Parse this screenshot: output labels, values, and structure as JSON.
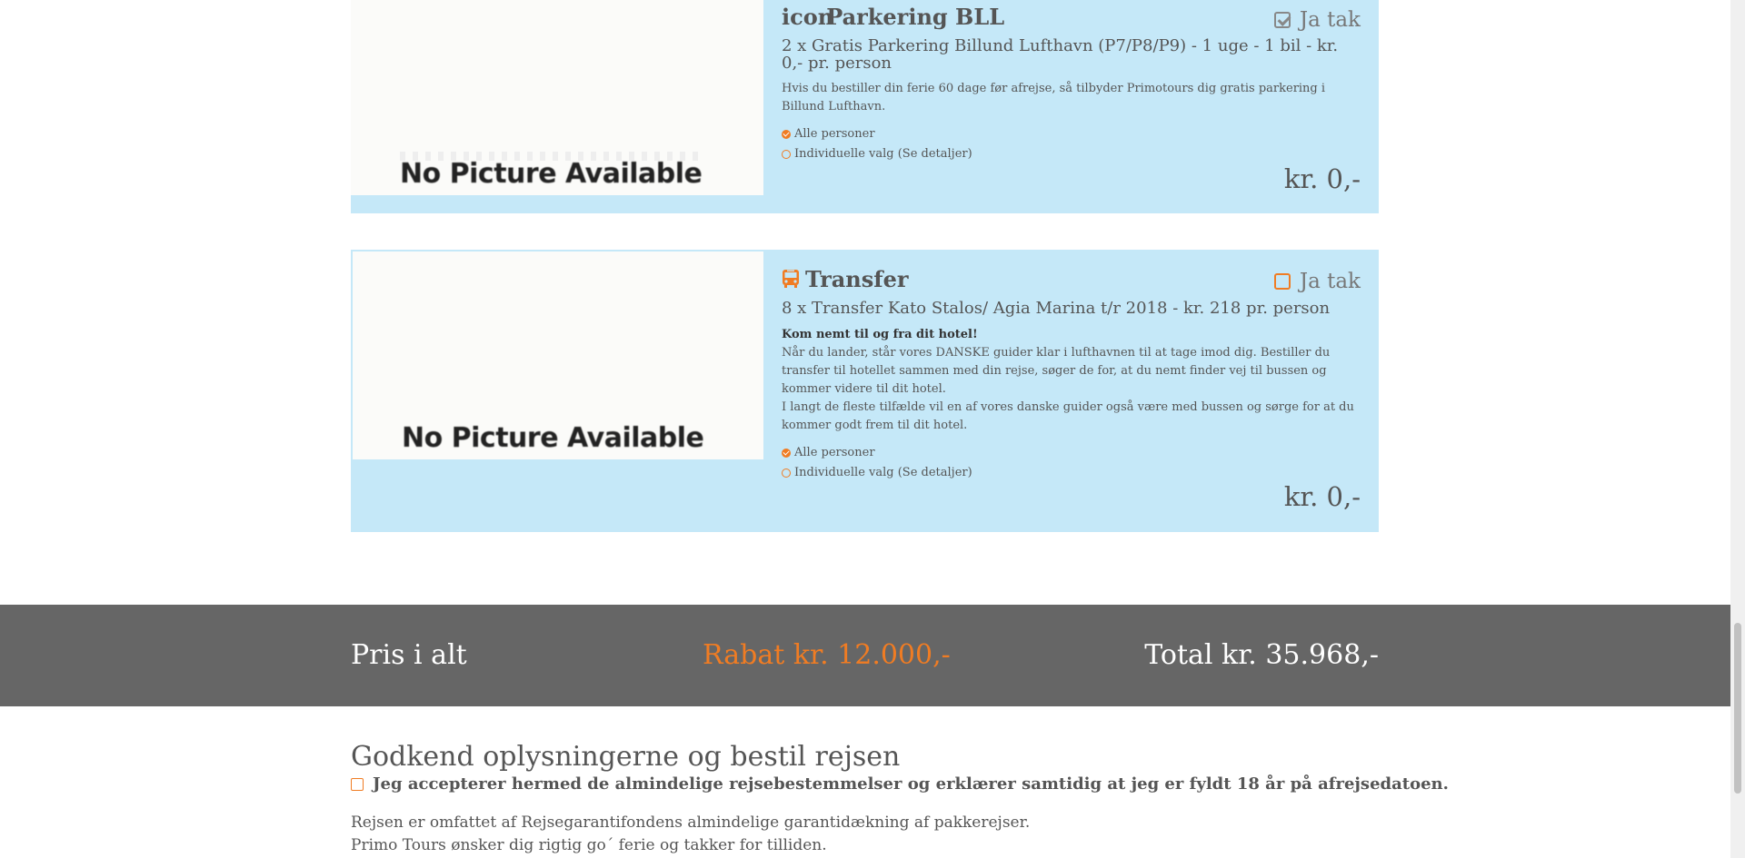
{
  "extras": [
    {
      "title": "Parkering BLL",
      "icon_alt_text": "icon",
      "icon": "broken-image-icon",
      "selected": true,
      "select_label": "Ja tak",
      "subtitle": "2 x Gratis Parkering Billund Lufthavn (P7/P8/P9) - 1 uge - 1 bil - kr. 0,- pr. person",
      "description_lines": [
        "Hvis du bestiller din ferie 60 dage før afrejse, så tilbyder Primotours dig gratis parkering i Billund Lufthavn."
      ],
      "image_text": "No Picture Available",
      "option_all": "Alle personer",
      "option_individual": "Individuelle valg (Se detaljer)",
      "price": "kr. 0,-"
    },
    {
      "title": "Transfer",
      "icon": "bus-icon",
      "selected": false,
      "select_label": "Ja tak",
      "subtitle": "8 x Transfer Kato Stalos/ Agia Marina t/r 2018 - kr. 218 pr. person",
      "description_heading": "Kom nemt til og fra dit hotel!",
      "description_lines": [
        "Når du lander, står vores DANSKE guider klar i lufthavnen til at tage imod dig. Bestiller du transfer til hotellet sammen med din rejse, søger de for, at du nemt finder vej til bussen og kommer videre til dit hotel.",
        "I langt de fleste tilfælde vil en af vores danske guider også være med bussen og sørge for at du kommer godt frem til dit hotel."
      ],
      "image_text": "No Picture Available",
      "option_all": "Alle personer",
      "option_individual": "Individuelle valg (Se detaljer)",
      "price": "kr. 0,-"
    }
  ],
  "totals": {
    "label": "Pris i alt",
    "discount": "Rabat kr. 12.000,-",
    "total": "Total kr. 35.968,-"
  },
  "approval": {
    "title": "Godkend oplysningerne og bestil rejsen",
    "accept_label": "Jeg accepterer hermed de almindelige rejsebestemmelser og erklærer samtidig at jeg er fyldt 18 år på afrejsedatoen.",
    "accepted": false,
    "note_1": "Rejsen er omfattet af Rejsegarantifondens almindelige garantidækning af pakkerejser.",
    "note_2": "Primo Tours ønsker dig rigtig go´ ferie og takker for tilliden."
  },
  "colors": {
    "accent": "#f07c23",
    "card_bg": "#c5e8f8",
    "bar_bg": "#666666"
  }
}
